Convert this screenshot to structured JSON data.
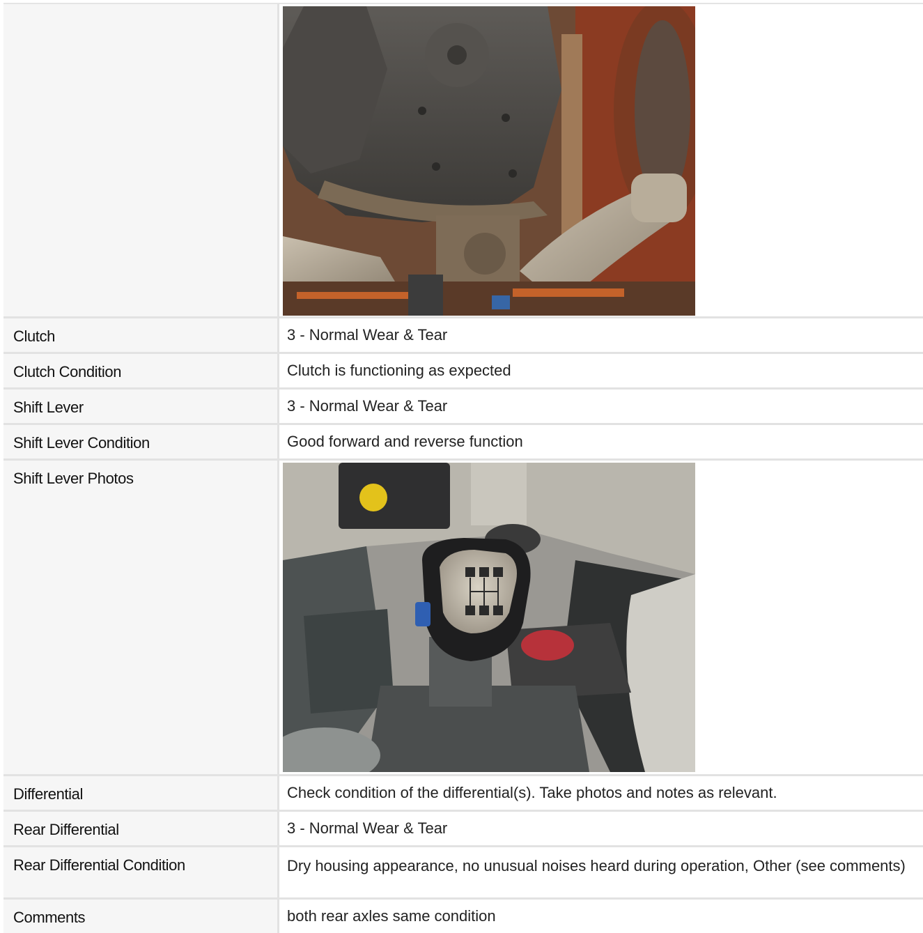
{
  "rows": [
    {
      "label": "",
      "type": "photo",
      "photo": "undercarriage-photo"
    },
    {
      "label": "Clutch",
      "value": "3 - Normal Wear & Tear"
    },
    {
      "label": "Clutch Condition",
      "value": "Clutch is functioning as expected"
    },
    {
      "label": "Shift Lever",
      "value": "3 - Normal Wear & Tear"
    },
    {
      "label": "Shift Lever Condition",
      "value": "Good forward and reverse function"
    },
    {
      "label": "Shift Lever Photos",
      "type": "photo",
      "photo": "shift-lever-photo"
    },
    {
      "label": "Differential",
      "value": "Check condition of the differential(s). Take photos and notes as relevant."
    },
    {
      "label": "Rear Differential",
      "value": "3 - Normal Wear & Tear"
    },
    {
      "label": "Rear Differential Condition",
      "value": "Dry housing appearance, no unusual noises heard during operation, Other (see comments)"
    },
    {
      "label": "Comments",
      "value": "both rear axles same condition"
    }
  ],
  "colors": {
    "label_bg": "#f6f6f6",
    "border": "#e2e2e2",
    "text": "#222222"
  }
}
